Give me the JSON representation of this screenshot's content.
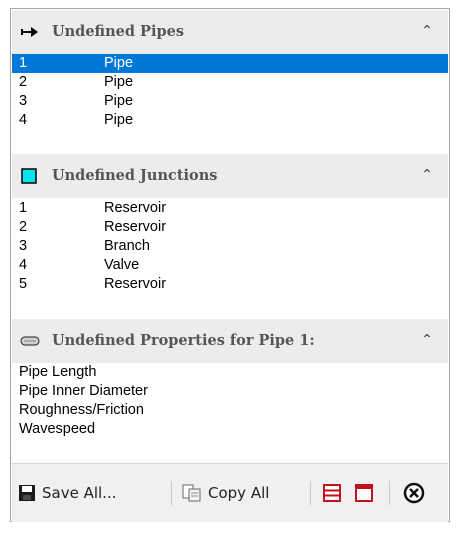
{
  "pipes": {
    "title": "Undefined Pipes",
    "icon": "pipe-arrow-icon",
    "items": [
      {
        "num": "1",
        "type": "Pipe",
        "selected": true
      },
      {
        "num": "2",
        "type": "Pipe"
      },
      {
        "num": "3",
        "type": "Pipe"
      },
      {
        "num": "4",
        "type": "Pipe"
      }
    ]
  },
  "junctions": {
    "title": "Undefined Junctions",
    "icon": "junction-square-icon",
    "items": [
      {
        "num": "1",
        "type": "Reservoir"
      },
      {
        "num": "2",
        "type": "Reservoir"
      },
      {
        "num": "3",
        "type": "Branch"
      },
      {
        "num": "4",
        "type": "Valve"
      },
      {
        "num": "5",
        "type": "Reservoir"
      }
    ]
  },
  "properties": {
    "title": "Undefined Properties for Pipe 1:",
    "icon": "pipe-segment-icon",
    "items": [
      "Pipe Length",
      "Pipe Inner Diameter",
      "Roughness/Friction",
      "Wavespeed"
    ]
  },
  "toolbar": {
    "save_all": "Save All...",
    "copy_all": "Copy All"
  },
  "colors": {
    "selection": "#0078d7",
    "header_bg": "#ececec",
    "junction_icon": "#00e5ee",
    "toolbar_red": "#c0141c"
  }
}
